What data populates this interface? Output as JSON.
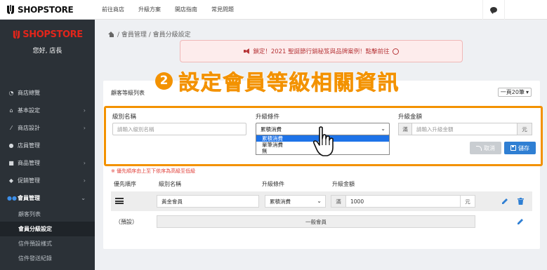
{
  "header": {
    "logo_text": "SHOPSTORE",
    "nav": [
      "前往商店",
      "升級方案",
      "開店指南",
      "常見問題"
    ],
    "chat_icon": "chat-bubble-icon"
  },
  "sidebar": {
    "brand_text": "SHOPSTORE",
    "greeting": "您好, 店長",
    "items": [
      {
        "label": "商店總覽",
        "icon": "dashboard-icon",
        "has_chevron": false
      },
      {
        "label": "基本設定",
        "icon": "bank-icon",
        "has_chevron": true
      },
      {
        "label": "商店設計",
        "icon": "magic-wand-icon",
        "has_chevron": true
      },
      {
        "label": "店員管理",
        "icon": "user-lock-icon",
        "has_chevron": false
      },
      {
        "label": "商品管理",
        "icon": "box-icon",
        "has_chevron": true
      },
      {
        "label": "促銷管理",
        "icon": "tags-icon",
        "has_chevron": true
      },
      {
        "label": "會員管理",
        "icon": "users-icon",
        "has_chevron": true,
        "active": true
      }
    ],
    "subitems": [
      "顧客列表",
      "會員分級設定",
      "信件預設樣式",
      "信件發送紀錄"
    ],
    "current_subitem": "會員分級設定"
  },
  "breadcrumb": {
    "icon": "home-icon",
    "text": "/ 會員管理 / 會員分級設定"
  },
  "promo": {
    "text": "鎖定！2021 聖誕節行銷秘笈與品牌案例！點擊前往",
    "color": "#b7373a"
  },
  "overlay": {
    "step": "❷",
    "title": "設定會員等級相關資訊",
    "color": "#f39200"
  },
  "panel": {
    "title": "顧客等級列表",
    "page_size": "一頁20筆"
  },
  "form": {
    "level_name_label": "級別名稱",
    "level_name_placeholder": "請輸入級別名稱",
    "condition_label": "升級條件",
    "condition_value": "累積消費",
    "condition_options": [
      "累積消費",
      "單筆消費",
      "無"
    ],
    "highlighted_option": "累積消費",
    "amount_label": "升級金額",
    "amount_prefix": "滿",
    "amount_placeholder": "請輸入升級金額",
    "amount_suffix": "元",
    "cancel_label": "取消",
    "save_label": "儲存"
  },
  "hint": "※ 優先順序由上至下依序為高級至低級",
  "table": {
    "headers": [
      "優先順序",
      "級別名稱",
      "升級條件",
      "升級金額"
    ],
    "rows": [
      {
        "name": "黃金會員",
        "condition": "累積消費",
        "prefix": "滿",
        "amount": "1000",
        "suffix": "元"
      }
    ],
    "default_row": {
      "label": "（預設）",
      "name": "一般會員"
    }
  },
  "colors": {
    "accent_orange": "#f39200",
    "primary_blue": "#2f7fd3",
    "sidebar_bg": "#2b3137",
    "brand_red": "#e1251b"
  }
}
